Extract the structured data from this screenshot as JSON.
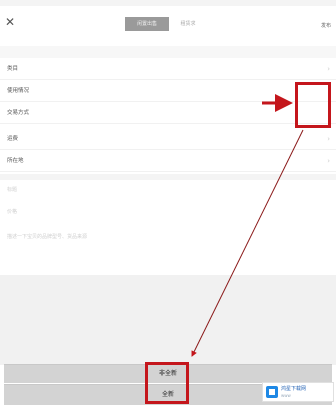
{
  "tabs": [
    {
      "label": "闲置出售"
    },
    {
      "label": "租赁求"
    }
  ],
  "header": {
    "publish_label": "发布"
  },
  "form_rows": [
    {
      "label": "类目"
    },
    {
      "label": "使用情况"
    },
    {
      "label": "交易方式"
    },
    {
      "label": "运费"
    },
    {
      "label": "所在地"
    }
  ],
  "fields": {
    "title_placeholder": "标题",
    "price_placeholder": "价格",
    "desc_placeholder": "描述一下宝贝的品牌型号、货品来源"
  },
  "sheet": {
    "option_nonew": "非全新",
    "option_new": "全新"
  },
  "watermark": {
    "title": "鸿星下载网",
    "sub": "www"
  },
  "colors": {
    "highlight": "#c4161c",
    "tab_active_bg": "#9a9a9a",
    "sheet_bg": "#d3d3d3"
  }
}
